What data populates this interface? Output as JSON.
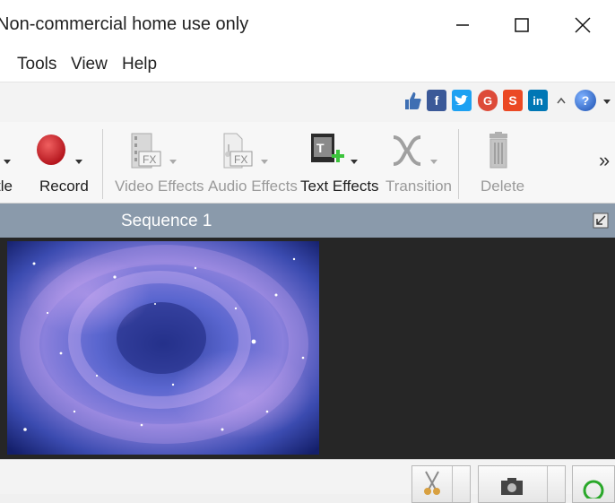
{
  "window": {
    "title": "Non-commercial home use only"
  },
  "menu": {
    "items": [
      "Tools",
      "View",
      "Help"
    ]
  },
  "social": {
    "icons": [
      "like-icon",
      "facebook-icon",
      "twitter-icon",
      "google-plus-icon",
      "stumbleupon-icon",
      "linkedin-icon",
      "chevron-up-icon",
      "help-icon"
    ],
    "colors": {
      "facebook": "#3b5998",
      "twitter": "#1da1f2",
      "google": "#dd4b39",
      "stumbleupon": "#eb4924",
      "linkedin": "#0077b5"
    }
  },
  "toolbar": {
    "title_partial": "tle",
    "record": "Record",
    "video_effects": "Video Effects",
    "audio_effects": "Audio Effects",
    "text_effects": "Text Effects",
    "transition": "Transition",
    "delete": "Delete",
    "overflow": "»"
  },
  "sequence": {
    "title": "Sequence 1"
  },
  "colors": {
    "sequence_bar": "#8a9aab",
    "record_red": "#d0212a",
    "preview_bg": "#262626"
  }
}
